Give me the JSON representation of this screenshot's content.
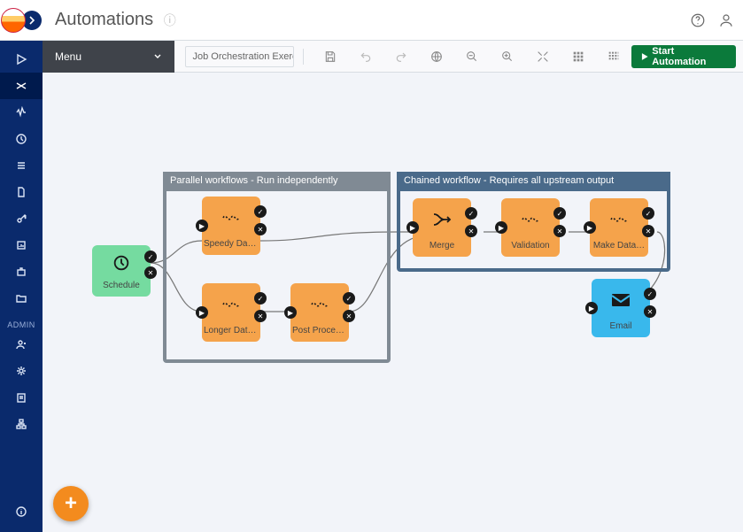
{
  "header": {
    "title": "Automations"
  },
  "toolbar": {
    "menu_label": "Menu",
    "job_name": "Job Orchestration Exerci…",
    "start_label": "Start Automation"
  },
  "sidebar": {
    "admin_label": "ADMIN"
  },
  "groups": {
    "parallel": {
      "title": "Parallel workflows - Run independently"
    },
    "chained": {
      "title": "Chained workflow - Requires all upstream output"
    }
  },
  "nodes": {
    "schedule": {
      "label": "Schedule"
    },
    "speedy": {
      "label": "Speedy Data…"
    },
    "longer": {
      "label": "Longer Data…"
    },
    "post": {
      "label": "Post Processi…"
    },
    "merge": {
      "label": "Merge"
    },
    "validation": {
      "label": "Validation"
    },
    "make": {
      "label": "Make Data…"
    },
    "email": {
      "label": "Email"
    }
  }
}
